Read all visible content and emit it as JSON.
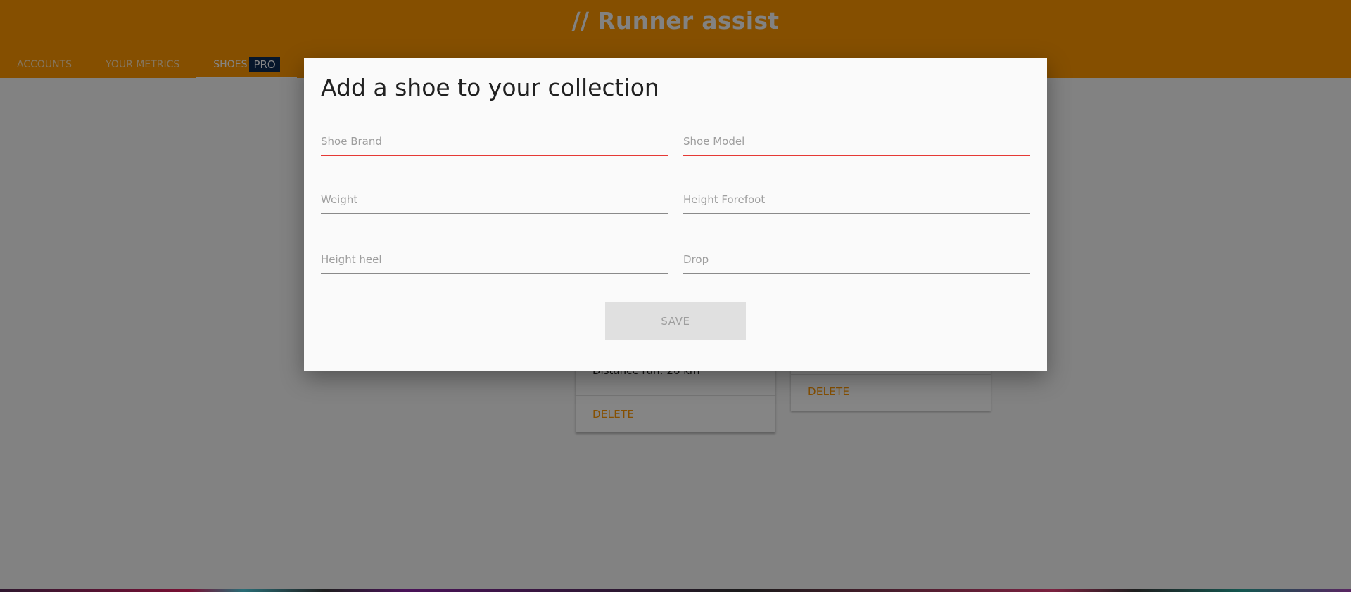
{
  "app": {
    "title": "// Runner assist",
    "accent_color": "#ff9800"
  },
  "tabs": [
    {
      "label": "ACCOUNTS",
      "active": false
    },
    {
      "label": "YOUR METRICS",
      "active": false
    },
    {
      "label": "SHOES",
      "badge": "PRO",
      "active": true
    }
  ],
  "cards": [
    {
      "info": "Distance run: 26 km",
      "delete_label": "DELETE"
    },
    {
      "info": "",
      "delete_label": "DELETE"
    }
  ],
  "modal": {
    "title": "Add a shoe to your collection",
    "fields": {
      "brand": {
        "placeholder": "Shoe Brand",
        "value": "",
        "invalid": true
      },
      "model": {
        "placeholder": "Shoe Model",
        "value": "",
        "invalid": true
      },
      "weight": {
        "placeholder": "Weight",
        "value": ""
      },
      "height_forefoot": {
        "placeholder": "Height Forefoot",
        "value": ""
      },
      "height_heel": {
        "placeholder": "Height heel",
        "value": ""
      },
      "drop": {
        "placeholder": "Drop",
        "value": ""
      }
    },
    "save_label": "SAVE",
    "save_disabled": true,
    "invalid_color": "#e53935"
  }
}
